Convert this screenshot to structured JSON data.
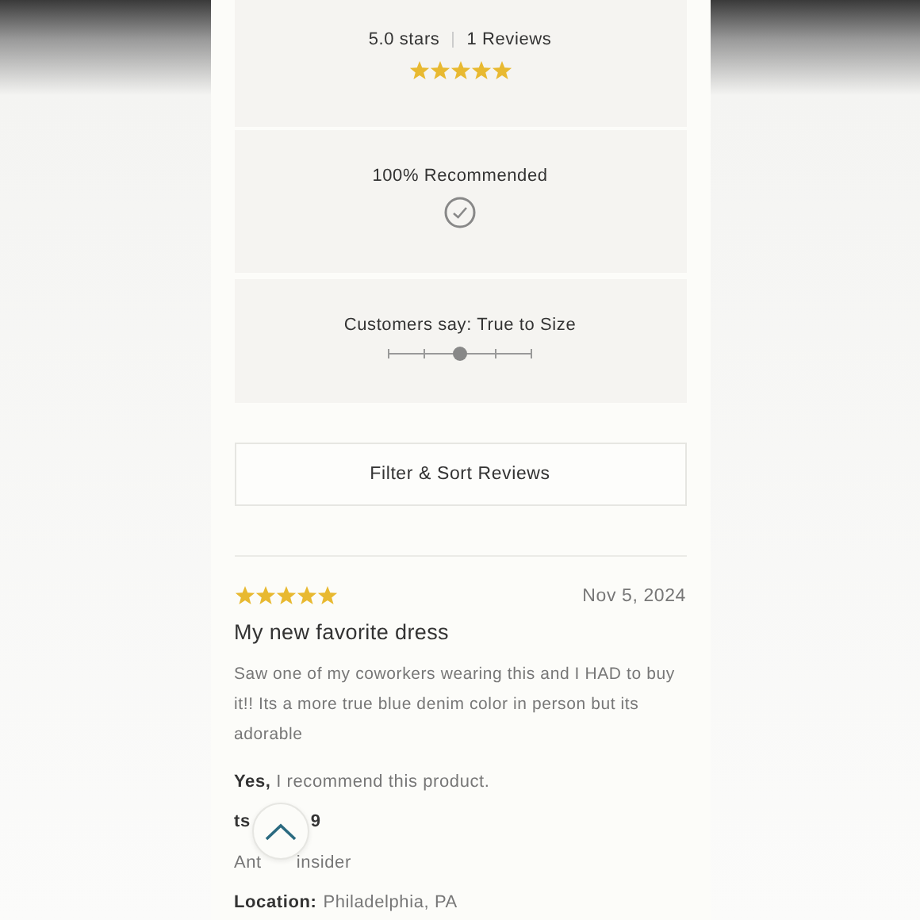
{
  "summary": {
    "rating": "5.0 stars",
    "review_count": "1 Reviews",
    "stars": 5
  },
  "recommended": {
    "label": "100% Recommended"
  },
  "fit": {
    "label": "Customers say: True to Size",
    "level": 0.5
  },
  "filter_button": {
    "label": "Filter & Sort Reviews"
  },
  "review": {
    "stars": 5,
    "date": "Nov 5, 2024",
    "title": "My new favorite dress",
    "body": "Saw one of my coworkers wearing this and I HAD to buy it!! Its a more true blue denim color in person but its adorable",
    "recommend": "**Yes,** I recommend this product.",
    "username_parts": [
      "ts",
      "9"
    ],
    "badge_parts": [
      "Ant",
      "insider"
    ],
    "location_label": "Location:",
    "location": "Philadelphia, PA"
  }
}
